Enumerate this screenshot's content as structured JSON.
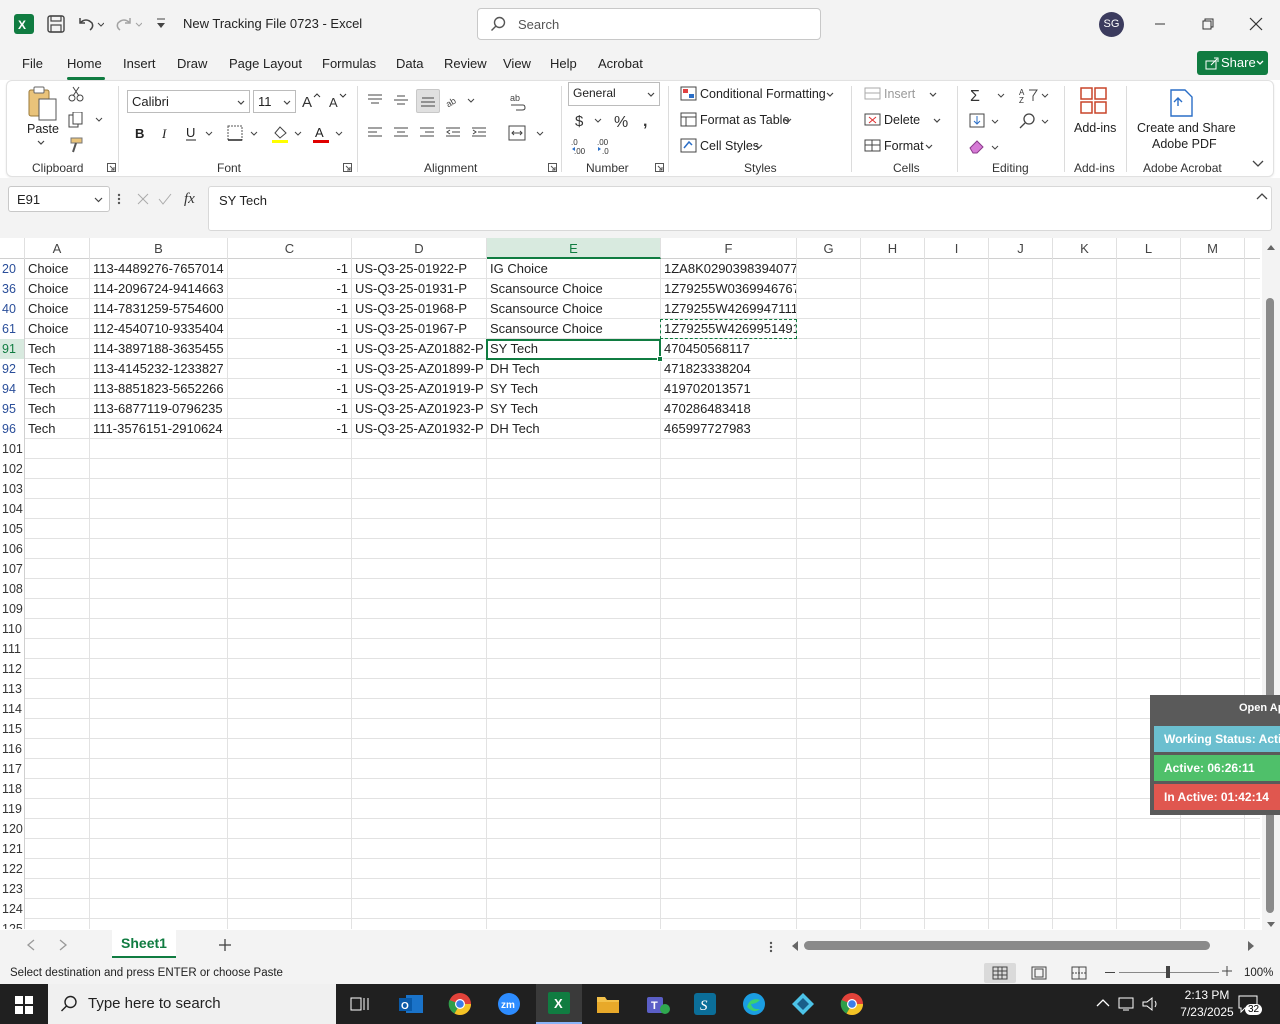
{
  "app": {
    "title": "New Tracking File 0723  -  Excel",
    "search_placeholder": "Search",
    "user_initials": "SG",
    "accent": "#107c41"
  },
  "menu": [
    "File",
    "Home",
    "Insert",
    "Draw",
    "Page Layout",
    "Formulas",
    "Data",
    "Review",
    "View",
    "Help",
    "Acrobat"
  ],
  "share_label": "Share",
  "ribbon": {
    "clipboard": {
      "paste": "Paste",
      "label": "Clipboard"
    },
    "font": {
      "name": "Calibri",
      "size": "11",
      "label": "Font"
    },
    "alignment": {
      "label": "Alignment"
    },
    "number": {
      "format": "General",
      "label": "Number"
    },
    "styles": {
      "conditional": "Conditional Formatting",
      "format_table": "Format as Table",
      "cell_styles": "Cell Styles",
      "label": "Styles"
    },
    "cells": {
      "insert": "Insert",
      "delete": "Delete",
      "format": "Format",
      "label": "Cells"
    },
    "editing": {
      "label": "Editing"
    },
    "addins": {
      "btn": "Add-ins",
      "label": "Add-ins"
    },
    "acrobat": {
      "line1": "Create and Share",
      "line2": "Adobe PDF",
      "label": "Adobe Acrobat"
    }
  },
  "formula_bar": {
    "name_box": "E91",
    "value": "SY Tech"
  },
  "columns": [
    "A",
    "B",
    "C",
    "D",
    "E",
    "F",
    "G",
    "H",
    "I",
    "J",
    "K",
    "L",
    "M"
  ],
  "rows": [
    {
      "n": "20",
      "a": "Choice",
      "b": "113-4489276-7657014",
      "c": "-1",
      "d": "US-Q3-25-01922-P",
      "e": "IG Choice",
      "f": "1ZA8K0290398394077"
    },
    {
      "n": "36",
      "a": "Choice",
      "b": "114-2096724-9414663",
      "c": "-1",
      "d": "US-Q3-25-01931-P",
      "e": "Scansource Choice",
      "f": "1Z79255W0369946767"
    },
    {
      "n": "40",
      "a": "Choice",
      "b": "114-7831259-5754600",
      "c": "-1",
      "d": "US-Q3-25-01968-P",
      "e": "Scansource Choice",
      "f": "1Z79255W4269947111"
    },
    {
      "n": "61",
      "a": "Choice",
      "b": "112-4540710-9335404",
      "c": "-1",
      "d": "US-Q3-25-01967-P",
      "e": "Scansource Choice",
      "f": "1Z79255W4269951491"
    },
    {
      "n": "91",
      "a": "Tech",
      "b": "114-3897188-3635455",
      "c": "-1",
      "d": "US-Q3-25-AZ01882-P",
      "e": "SY Tech",
      "f": "470450568117"
    },
    {
      "n": "92",
      "a": "Tech",
      "b": "113-4145232-1233827",
      "c": "-1",
      "d": "US-Q3-25-AZ01899-P",
      "e": "DH Tech",
      "f": "471823338204"
    },
    {
      "n": "94",
      "a": "Tech",
      "b": "113-8851823-5652266",
      "c": "-1",
      "d": "US-Q3-25-AZ01919-P",
      "e": "SY Tech",
      "f": "419702013571"
    },
    {
      "n": "95",
      "a": "Tech",
      "b": "113-6877119-0796235",
      "c": "-1",
      "d": "US-Q3-25-AZ01923-P",
      "e": "SY Tech",
      "f": "470286483418"
    },
    {
      "n": "96",
      "a": "Tech",
      "b": "111-3576151-2910624",
      "c": "-1",
      "d": "US-Q3-25-AZ01932-P",
      "e": "DH Tech",
      "f": "465997727983"
    }
  ],
  "empty_rows": [
    "101",
    "102",
    "103",
    "104",
    "105",
    "106",
    "107",
    "108",
    "109",
    "110",
    "111",
    "112",
    "113",
    "114",
    "115",
    "116",
    "117",
    "118",
    "119",
    "120",
    "121",
    "122",
    "123",
    "124",
    "125"
  ],
  "sheet_tab": "Sheet1",
  "status": {
    "message": "Select destination and press ENTER or choose Paste",
    "zoom": "100%"
  },
  "widget": {
    "open": "Open Ap",
    "working": "Working Status: Acti",
    "active": "Active: 06:26:11",
    "inactive": "In Active: 01:42:14",
    "working_color": "#6bbfcf",
    "active_color": "#4fc06a",
    "inactive_color": "#e0574f"
  },
  "taskbar": {
    "search": "Type here to search",
    "time": "2:13 PM",
    "date": "7/23/2025",
    "notifications": "32"
  }
}
